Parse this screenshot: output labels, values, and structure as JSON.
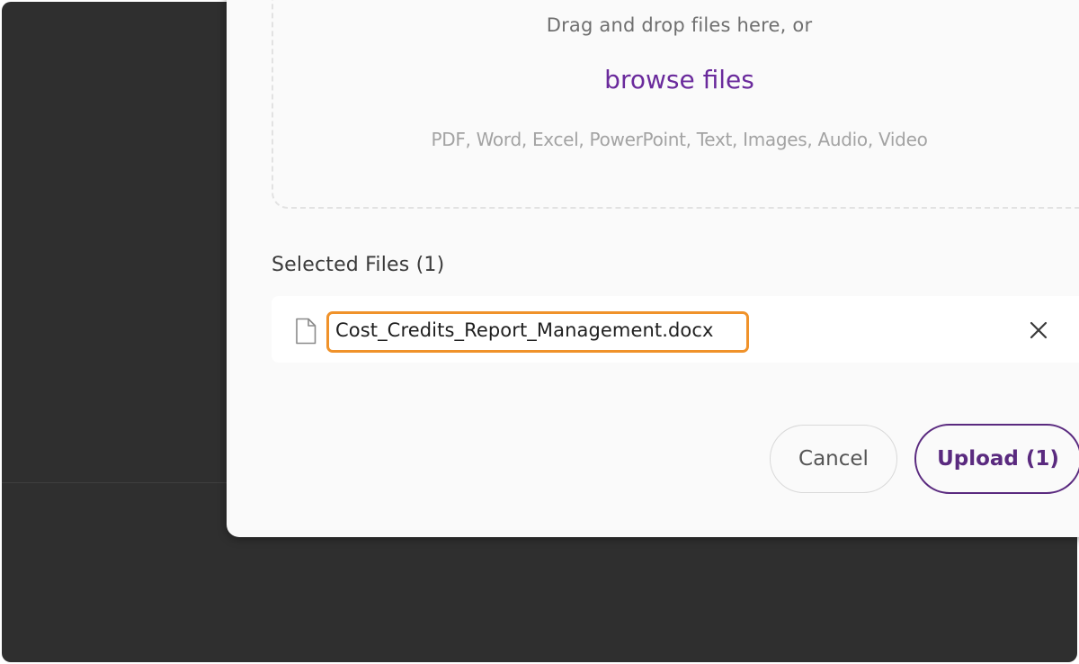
{
  "dropzone": {
    "instruction": "Drag and drop files here, or",
    "browse_label": "browse files",
    "supported_types": "PDF, Word, Excel, PowerPoint, Text, Images, Audio, Video"
  },
  "selected_files": {
    "title": "Selected Files (1)",
    "items": [
      {
        "icon": "file-icon",
        "name": "Cost_Credits_Report_Management.docx",
        "remove_icon": "close-icon"
      }
    ]
  },
  "actions": {
    "cancel_label": "Cancel",
    "upload_label": "Upload (1)"
  },
  "colors": {
    "backdrop": "#2f2f2f",
    "modal_bg": "#fafafa",
    "link_purple": "#6a2a9c",
    "upload_border": "#5a2a7f",
    "highlight_orange": "#f0922a"
  }
}
